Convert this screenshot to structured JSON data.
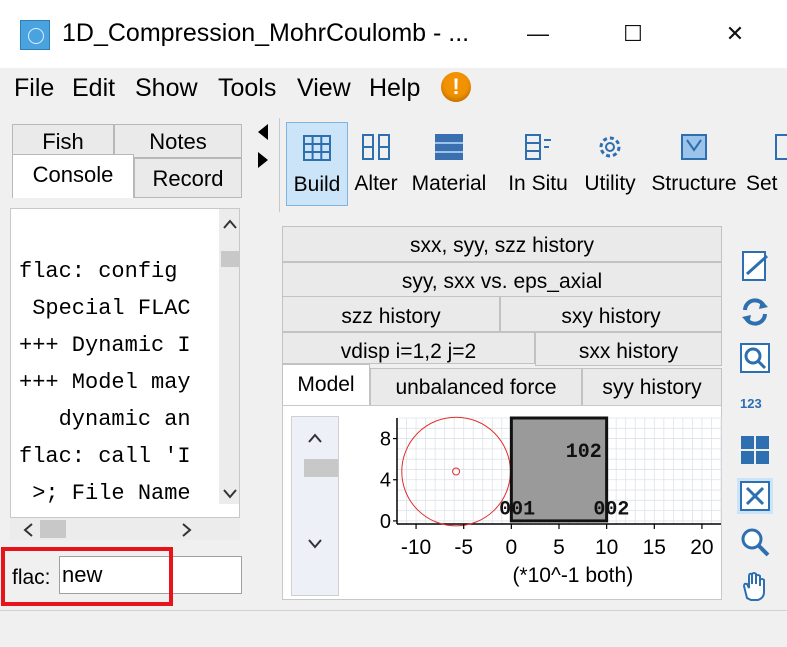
{
  "window": {
    "title": "1D_Compression_MohrCoulomb - ...",
    "minimize_glyph": "—",
    "maximize_glyph": "☐",
    "close_glyph": "✕"
  },
  "menubar": {
    "items": [
      "File",
      "Edit",
      "Show",
      "Tools",
      "View",
      "Help"
    ],
    "warning_glyph": "!"
  },
  "left_tabs": {
    "row1": [
      "Fish",
      "Notes"
    ],
    "row2": [
      "Console",
      "Record"
    ]
  },
  "console": {
    "lines": [
      "flac: config",
      " Special FLAC",
      "+++ Dynamic I",
      "+++ Model may",
      "   dynamic an",
      "flac: call 'I",
      " >; File Name"
    ]
  },
  "command": {
    "label": "flac:",
    "value": "new"
  },
  "toolbar": {
    "items": [
      "Build",
      "Alter",
      "Material",
      "In Situ",
      "Utility",
      "Structure",
      "Set"
    ]
  },
  "plot_tabs": {
    "row1": [
      "sxx, syy, szz history"
    ],
    "row2": [
      "syy, sxx vs. eps_axial"
    ],
    "row3": [
      "szz history",
      "sxy history"
    ],
    "row4": [
      "vdisp i=1,2 j=2",
      "sxx history"
    ],
    "row5": [
      "Model",
      "unbalanced force",
      "syy history"
    ]
  },
  "chart_data": {
    "type": "scatter",
    "x_ticks": [
      "-10",
      "-5",
      "0",
      "5",
      "10",
      "15",
      "20"
    ],
    "y_ticks": [
      "0",
      "4",
      "8"
    ],
    "xlabel": "(*10^-1 both)",
    "xlim": [
      -12,
      22
    ],
    "ylim": [
      -0.3,
      10
    ],
    "grid": true,
    "overlay_labels": [
      "102",
      "001",
      "002"
    ],
    "mohr_circle": {
      "center_x": -5.8,
      "center_y": 4.8,
      "radius": 5.7
    },
    "grid_block": {
      "x0": 0,
      "x1": 10,
      "y0": 0,
      "y1": 10
    }
  }
}
